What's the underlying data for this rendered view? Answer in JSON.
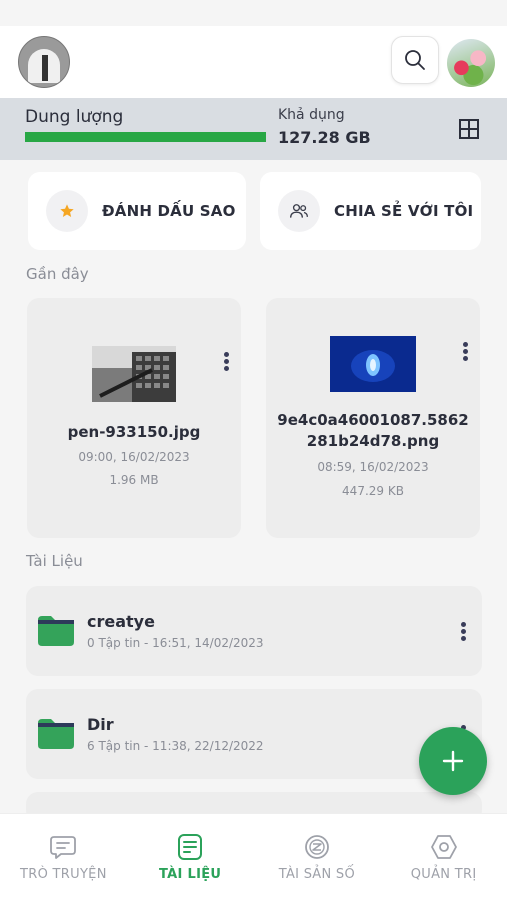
{
  "storage": {
    "label": "Dung lượng",
    "available_label": "Khả dụng",
    "available_value": "127.28 GB",
    "used_fraction": 1.0
  },
  "quick_actions": {
    "starred": "ĐÁNH DẤU SAO",
    "shared": "CHIA SẺ VỚI TÔI"
  },
  "recent": {
    "title": "Gần đây",
    "files": [
      {
        "name": "pen-933150.jpg",
        "date": "09:00, 16/02/2023",
        "size": "1.96 MB"
      },
      {
        "name": "9e4c0a46001087.5862281b24d78.png",
        "date": "08:59, 16/02/2023",
        "size": "447.29 KB"
      }
    ]
  },
  "documents": {
    "title": "Tài Liệu",
    "folders": [
      {
        "name": "creatye",
        "meta": "0 Tập tin - 16:51, 14/02/2023"
      },
      {
        "name": "Dir",
        "meta": "6 Tập tin - 11:38, 22/12/2022"
      }
    ]
  },
  "nav": {
    "items": [
      {
        "label": "TRÒ TRUYỆN",
        "icon": "chat-icon"
      },
      {
        "label": "TÀI LIỆU",
        "icon": "document-icon"
      },
      {
        "label": "TÀI SẢN SỐ",
        "icon": "digital-asset-icon"
      },
      {
        "label": "QUẢN TRỊ",
        "icon": "admin-icon"
      }
    ],
    "active": "TÀI LIỆU"
  },
  "colors": {
    "accent": "#2ba25a",
    "storage_bar": "#28a745",
    "star": "#f5a623"
  }
}
